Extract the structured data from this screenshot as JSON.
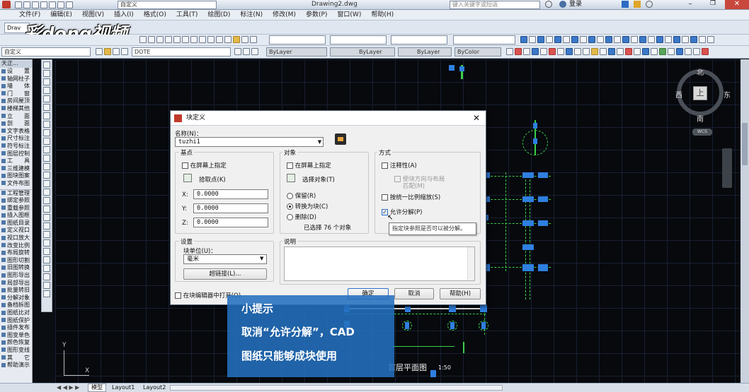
{
  "titlebar": {
    "workspace": "自定义",
    "filename": "Drawing2.dwg",
    "search_placeholder": "键入关键字或短语",
    "login": "登录"
  },
  "menu": [
    "文件(F)",
    "编辑(E)",
    "视图(V)",
    "插入(I)",
    "格式(O)",
    "工具(T)",
    "绘图(D)",
    "标注(N)",
    "修改(M)",
    "参数(P)",
    "窗口(W)",
    "帮助(H)"
  ],
  "doc_tab": "Drav",
  "watermark": "彩dong视频",
  "layer_toolbar": {
    "workspace": "自定义",
    "layer": "DOTE",
    "color": "ByLayer",
    "linetype": "ByLayer",
    "lineweight": "ByLayer",
    "plotstyle": "ByColor"
  },
  "panel": {
    "header": "天正...",
    "items1": [
      "设　　置",
      "轴网柱子",
      "墙　　体",
      "门　　窗",
      "房间屋顶",
      "楼梯其他",
      "立　　面",
      "剖　　面",
      "文字表格",
      "尺寸标注",
      "符号标注",
      "图层控制",
      "工　　具",
      "三维建模",
      "图块图案",
      "文件布图"
    ],
    "items2": [
      "工程管理",
      "绑定参照",
      "重载参照",
      "插入图框",
      "图纸目录",
      "定义视口",
      "视口放大",
      "改变比例",
      "布局旋转",
      "图形切割",
      "旧图转换",
      "图形导出",
      "局部导出",
      "批量转旧",
      "分解对象",
      "备档拆图",
      "图纸比对",
      "图纸保护",
      "插件发布",
      "图变单色",
      "颜色恢复",
      "图形变线",
      "其　　它",
      "帮助演示"
    ]
  },
  "compass": {
    "north": "北",
    "south": "南",
    "east": "东",
    "west": "西",
    "center": "上",
    "wcs": "WCS"
  },
  "drawing_label": "首层平面图",
  "drawing_scale": "1:50",
  "ucs": {
    "y": "Y",
    "x": "X"
  },
  "layout_tabs": [
    "模型",
    "Layout1",
    "Layout2"
  ],
  "dialog": {
    "title": "块定义",
    "name_label": "名称(N)：",
    "name_value": "tuzhi1",
    "base": {
      "title": "基点",
      "onscreen": "在屏幕上指定",
      "pick": "拾取点(K)",
      "x_label": "X:",
      "x": "0.0000",
      "y_label": "Y:",
      "y": "0.0000",
      "z_label": "Z:",
      "z": "0.0000"
    },
    "objects": {
      "title": "对象",
      "onscreen": "在屏幕上指定",
      "select": "选择对象(T)",
      "retain": "保留(R)",
      "convert": "转换为块(C)",
      "delete": "删除(D)",
      "count": "已选择 76 个对象"
    },
    "behavior": {
      "title": "方式",
      "annotative": "注释性(A)",
      "match": "使块方向与布局",
      "match2": "匹配(M)",
      "uniform": "按统一比例缩放(S)",
      "explode": "允许分解(P)"
    },
    "tooltip": "指定块参照是否可以被分解。",
    "settings": {
      "title": "设置",
      "unit_label": "块单位(U)：",
      "unit": "毫米",
      "hyperlink": "超链接(L)..."
    },
    "desc": {
      "title": "说明"
    },
    "open_in_editor": "在块编辑器中打开(O)",
    "ok": "确定",
    "cancel": "取消",
    "help": "帮助(H)"
  },
  "tip": {
    "title": "小提示",
    "line1": "取消“允许分解”，CAD",
    "line2": "图纸只能够成块使用"
  },
  "colors": {
    "accent": "#2470be",
    "canvas": "#07090d",
    "entity_blue": "#2f7fe0",
    "entity_green": "#39d049"
  }
}
